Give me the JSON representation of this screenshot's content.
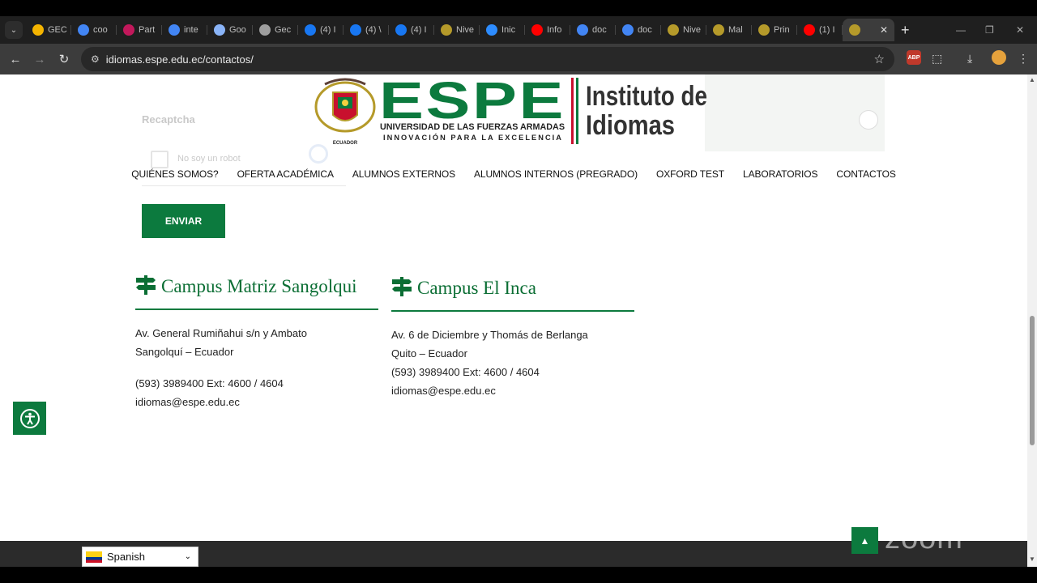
{
  "browser": {
    "tabs": [
      {
        "label": "GEC",
        "icon": "google-drive-icon",
        "color": "#f4b400"
      },
      {
        "label": "coo",
        "icon": "google-icon",
        "color": "#4285f4"
      },
      {
        "label": "Part",
        "icon": "partner-icon",
        "color": "#c2185b"
      },
      {
        "label": "inte",
        "icon": "google-icon",
        "color": "#4285f4"
      },
      {
        "label": "Goo",
        "icon": "gemini-icon",
        "color": "#8ab4f8"
      },
      {
        "label": "Gec",
        "icon": "loading-icon",
        "color": "#9e9e9e"
      },
      {
        "label": "(4) I",
        "icon": "facebook-icon",
        "color": "#1877f2"
      },
      {
        "label": "(4) \\",
        "icon": "facebook-icon",
        "color": "#1877f2"
      },
      {
        "label": "(4) I",
        "icon": "facebook-icon",
        "color": "#1877f2"
      },
      {
        "label": "Nive",
        "icon": "espe-icon",
        "color": "#b59a2a"
      },
      {
        "label": "Inic",
        "icon": "zoom-icon",
        "color": "#2d8cff"
      },
      {
        "label": "Info",
        "icon": "youtube-icon",
        "color": "#ff0000"
      },
      {
        "label": "doc",
        "icon": "google-icon",
        "color": "#4285f4"
      },
      {
        "label": "doc",
        "icon": "google-icon",
        "color": "#4285f4"
      },
      {
        "label": "Nive",
        "icon": "espe-icon",
        "color": "#b59a2a"
      },
      {
        "label": "Mal",
        "icon": "espe-icon",
        "color": "#b59a2a"
      },
      {
        "label": "Prin",
        "icon": "espe-icon",
        "color": "#b59a2a"
      },
      {
        "label": "(1) I",
        "icon": "youtube-icon",
        "color": "#ff0000"
      }
    ],
    "url": "idiomas.espe.edu.ec/contactos/"
  },
  "logo": {
    "brand": "ESPE",
    "university": "UNIVERSIDAD DE LAS FUERZAS ARMADAS",
    "motto": "INNOVACIÓN PARA LA EXCELENCIA",
    "country": "ECUADOR",
    "institute_line1": "Instituto de",
    "institute_line2": "Idiomas"
  },
  "form": {
    "recaptcha_label": "Recaptcha",
    "captcha_text": "No soy un robot",
    "submit_label": "ENVIAR"
  },
  "nav": [
    "QUIÉNES SOMOS?",
    "OFERTA ACADÉMICA",
    "ALUMNOS EXTERNOS",
    "ALUMNOS INTERNOS (PREGRADO)",
    "OXFORD TEST",
    "LABORATORIOS",
    "CONTACTOS"
  ],
  "campus_matriz": {
    "title": "Campus Matriz Sangolqui",
    "address": "Av. General Rumiñahui s/n y Ambato",
    "city": "Sangolquí – Ecuador",
    "phone": "(593) 3989400 Ext: 4600 / 4604",
    "email": "idiomas@espe.edu.ec"
  },
  "campus_inca": {
    "title": "Campus El Inca",
    "address": "Av. 6 de Diciembre y Thomás de Berlanga",
    "city": "Quito – Ecuador",
    "phone": "(593) 3989400 Ext: 4600 / 4604",
    "email": "idiomas@espe.edu.ec"
  },
  "language_selector": {
    "value": "Spanish"
  },
  "watermark": "zoom",
  "colors": {
    "brand_green": "#0c7a3e",
    "brand_red": "#c8102e"
  }
}
